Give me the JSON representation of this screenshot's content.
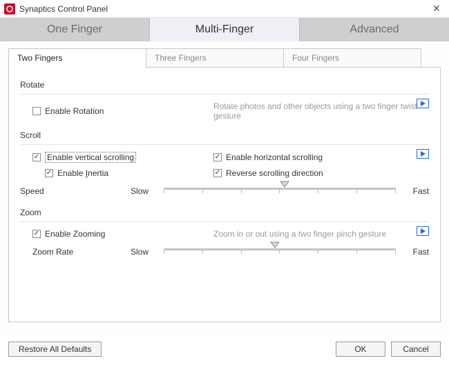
{
  "window": {
    "title": "Synaptics Control Panel"
  },
  "mainTabs": {
    "oneFinger": "One Finger",
    "multiFinger": "Multi-Finger",
    "advanced": "Advanced"
  },
  "subTabs": {
    "twoFingers": "Two Fingers",
    "threeFingers": "Three Fingers",
    "fourFingers": "Four Fingers"
  },
  "rotate": {
    "title": "Rotate",
    "enableLabel": "Enable Rotation",
    "enableChecked": false,
    "desc": "Rotate photos and other objects using a two finger twist gesture"
  },
  "scroll": {
    "title": "Scroll",
    "vertical": {
      "label": "Enable vertical scrolling",
      "checked": true
    },
    "horizontal": {
      "label": "Enable horizontal scrolling",
      "checked": true
    },
    "inertia": {
      "prefix": "Enable ",
      "letter": "I",
      "suffix": "nertia",
      "checked": true
    },
    "reverse": {
      "label": "Reverse scrolling direction",
      "checked": true
    },
    "speedLabel": "Speed",
    "slow": "Slow",
    "fast": "Fast",
    "speedValuePct": 52
  },
  "zoom": {
    "title": "Zoom",
    "enable": {
      "label": "Enable Zooming",
      "checked": true
    },
    "desc": "Zoom in or out using a two finger pinch gesture",
    "rateLabel": "Zoom Rate",
    "slow": "Slow",
    "fast": "Fast",
    "rateValuePct": 48
  },
  "buttons": {
    "restore": "Restore All Defaults",
    "ok": "OK",
    "cancel": "Cancel"
  }
}
